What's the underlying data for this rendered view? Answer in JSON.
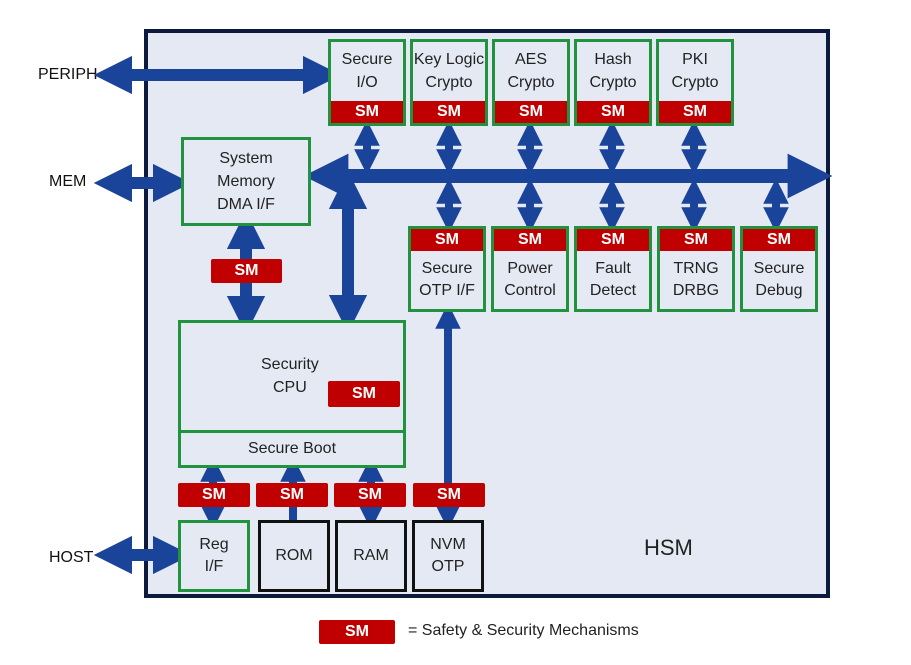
{
  "diagram": {
    "title": "HSM",
    "external_interfaces": [
      "PERIPH",
      "MEM",
      "HOST"
    ],
    "sm_label": "SM",
    "top_blocks": [
      {
        "label": "Secure\nI/O",
        "sm": "SM"
      },
      {
        "label": "Key Logic\nCrypto",
        "sm": "SM"
      },
      {
        "label": "AES\nCrypto",
        "sm": "SM"
      },
      {
        "label": "Hash\nCrypto",
        "sm": "SM"
      },
      {
        "label": "PKI\nCrypto",
        "sm": "SM"
      }
    ],
    "bus_blocks": [
      {
        "label": "Secure\nOTP I/F",
        "sm": "SM"
      },
      {
        "label": "Power\nControl",
        "sm": "SM"
      },
      {
        "label": "Fault\nDetect",
        "sm": "SM"
      },
      {
        "label": "TRNG\nDRBG",
        "sm": "SM"
      },
      {
        "label": "Secure\nDebug",
        "sm": "SM"
      }
    ],
    "dma_block": {
      "label": "System\nMemory\nDMA I/F"
    },
    "cpu_block": {
      "label": "Security\nCPU",
      "sm": "SM",
      "footer": "Secure Boot"
    },
    "bottom_blocks": [
      {
        "label": "Reg\nI/F",
        "sm": "SM"
      },
      {
        "label": "ROM",
        "sm": "SM"
      },
      {
        "label": "RAM",
        "sm": "SM"
      },
      {
        "label": "NVM\nOTP",
        "sm": "SM"
      }
    ],
    "dma_link_sm": "SM",
    "legend": {
      "swatch": "SM",
      "text": "= Safety & Security Mechanisms"
    },
    "colors": {
      "sm_red": "#c00000",
      "block_border_green": "#21933f",
      "arrow_blue": "#1a4499",
      "frame_navy": "#0b1a3d",
      "fill": "#e5e9f4"
    }
  }
}
